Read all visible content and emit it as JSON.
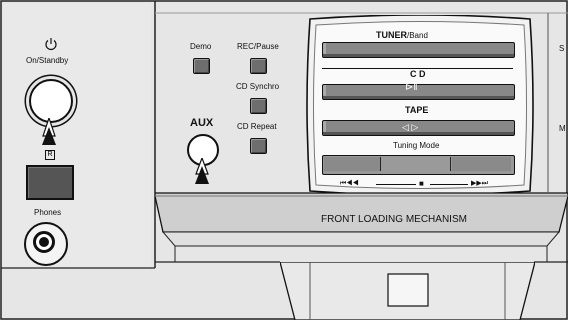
{
  "left_panel": {
    "power_icon": "power-icon",
    "on_standby_label": "On/Standby",
    "remote_sensor_label": "R",
    "phones_label": "Phones"
  },
  "control_buttons": {
    "demo_label": "Demo",
    "rec_pause_label": "REC/Pause",
    "cd_synchro_label": "CD Synchro",
    "aux_label": "AUX",
    "cd_repeat_label": "CD Repeat"
  },
  "selector": {
    "tuner_label": "TUNER",
    "band_label": "/Band",
    "cd_label": "C D",
    "cd_symbol": "⊳‖",
    "tape_label": "TAPE",
    "tape_symbol": "◁ ▷",
    "tuning_mode_label": "Tuning Mode",
    "rewind_symbol": "⏮◀◀",
    "stop_symbol": "■",
    "forward_symbol": "▶▶⏭"
  },
  "front_loading": {
    "label": "FRONT LOADING MECHANISM"
  },
  "right_edge": {
    "s_letter": "S",
    "m_letter": "M"
  },
  "colors": {
    "panel": "#e6e6e6",
    "dark_button": "#555555",
    "outline": "#111111"
  }
}
